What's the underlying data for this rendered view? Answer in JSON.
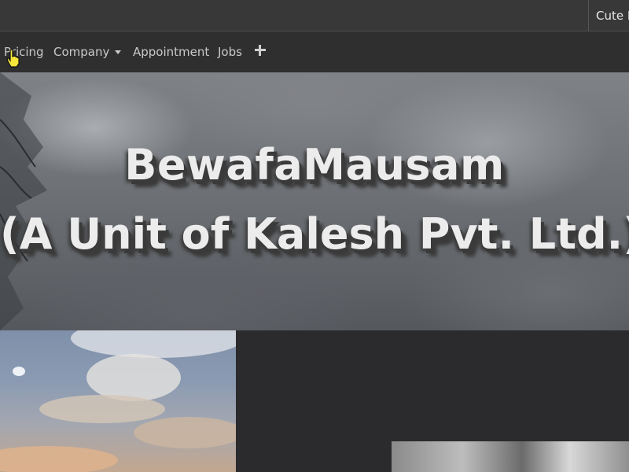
{
  "topbar": {
    "user_link": "Cute L"
  },
  "nav": {
    "items": [
      {
        "label": "Pricing"
      },
      {
        "label": "Company"
      },
      {
        "label": "Appointment"
      },
      {
        "label": "Jobs"
      }
    ],
    "add_icon": "plus-icon"
  },
  "hero": {
    "title_line1": "BewafaMausam",
    "title_line2": "(A Unit of Kalesh Pvt. Ltd.)"
  },
  "colors": {
    "topbar_bg": "#383839",
    "navbar_bg": "#2f2f30",
    "page_bg": "#2b2b2d",
    "hero_text": "#ececec"
  }
}
